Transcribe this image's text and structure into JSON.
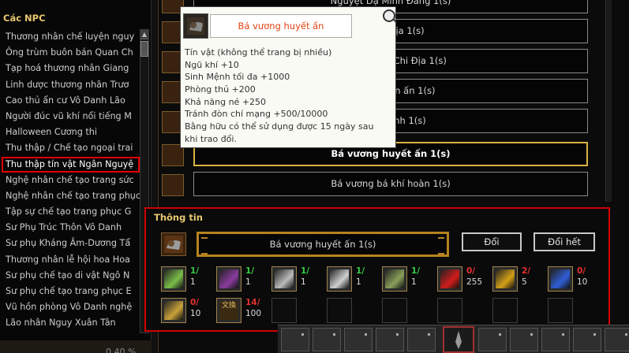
{
  "npc_panel": {
    "title": "Các NPC",
    "items": [
      {
        "label": "Thương nhân chế luyện nguy"
      },
      {
        "label": "Ông trùm buôn bán Quan Ch"
      },
      {
        "label": "Tạp hoá thương nhân Giang"
      },
      {
        "label": "Linh dược thương nhân Trươ"
      },
      {
        "label": "Cao thủ ẩn cư Vô Danh Lão"
      },
      {
        "label": "Người đúc vũ khí nổi tiếng M"
      },
      {
        "label": "Halloween Cương thi"
      },
      {
        "label": "Thu thập / Chế tạo ngoại trai"
      },
      {
        "label": "Thu thập tín vật Ngân Nguyệ"
      },
      {
        "label": "Nghệ nhân chế tạo trang sức"
      },
      {
        "label": "Nghệ nhân chế tạo trang phục"
      },
      {
        "label": "Tập sự chế tạo trang phục G"
      },
      {
        "label": "Sư Phụ Trúc Thôn Vô Danh"
      },
      {
        "label": "Sư phụ Kháng Âm-Dương Tẩ"
      },
      {
        "label": "Thương nhân lễ hội hoa Hoa"
      },
      {
        "label": "Sư phụ chế tạo di vật Ngô N"
      },
      {
        "label": "Sư phụ chế tạo trang phục E"
      },
      {
        "label": "Vũ hồn phòng Vô Danh nghệ"
      },
      {
        "label": "Lão nhân Nguy Xuân Tân"
      }
    ],
    "selected_index": 8,
    "footer_percent": "0.40 %"
  },
  "recipes": [
    {
      "label": "Nguyệt Dạ Minh Đang 1(s)"
    },
    {
      "label": "Vô Sát Địa 1(s)"
    },
    {
      "label": "Diêm Vương Chi Địa 1(s)"
    },
    {
      "label": "Thông thiên ấn 1(s)"
    },
    {
      "label": "Thiên Lệnh 1(s)"
    },
    {
      "label": "Bá vương huyết ấn 1(s)"
    },
    {
      "label": "Bá vương bá khí hoàn 1(s)"
    }
  ],
  "active_recipe_index": 5,
  "tooltip": {
    "item_name": "Bá vương huyết ấn",
    "lines": [
      "Tín vật (không thể trang bị nhiều)",
      "Ngũ khí +10",
      "Sinh Mệnh tối đa +1000",
      "Phòng thủ +200",
      "Khả năng né +250",
      "Tránh đòn chí mạng +500/10000",
      "Bằng hữu có thể sử dụng được 15 ngày sau",
      "khi trao đổi."
    ]
  },
  "info_panel": {
    "title": "Thông tin",
    "result_label": "Bá vương huyết ấn 1(s)",
    "exchange_label": "Đổi",
    "exchange_all_label": "Đổi hết",
    "materials": [
      {
        "have": "1/",
        "need": "1",
        "status": "ok",
        "icon": "grass-blade-icon",
        "color": "#7bbd4a"
      },
      {
        "have": "1/",
        "need": "1",
        "status": "ok",
        "icon": "purple-cloth-icon",
        "color": "#8a3c9e"
      },
      {
        "have": "1/",
        "need": "1",
        "status": "ok",
        "icon": "dagger-icon",
        "color": "#bbbbbb"
      },
      {
        "have": "1/",
        "need": "1",
        "status": "ok",
        "icon": "sword-icon",
        "color": "#d0d0d0"
      },
      {
        "have": "1/",
        "need": "1",
        "status": "ok",
        "icon": "spear-icon",
        "color": "#8aa05a"
      },
      {
        "have": "0/",
        "need": "255",
        "status": "bad",
        "icon": "red-potion-icon",
        "color": "#d21c1c"
      },
      {
        "have": "2/",
        "need": "5",
        "status": "bad",
        "icon": "golden-scroll-icon",
        "color": "#d4a017"
      },
      {
        "have": "0/",
        "need": "10",
        "status": "bad",
        "icon": "blue-gem-icon",
        "color": "#2f5ed6"
      },
      {
        "have": "0/",
        "need": "10",
        "status": "bad",
        "icon": "golden-ticket-icon",
        "color": "#c9a23a"
      },
      {
        "have": "14/",
        "need": "100",
        "status": "bad",
        "icon": "exchange-book-icon",
        "glyph": "文換",
        "color": "#e5c36a"
      }
    ]
  }
}
